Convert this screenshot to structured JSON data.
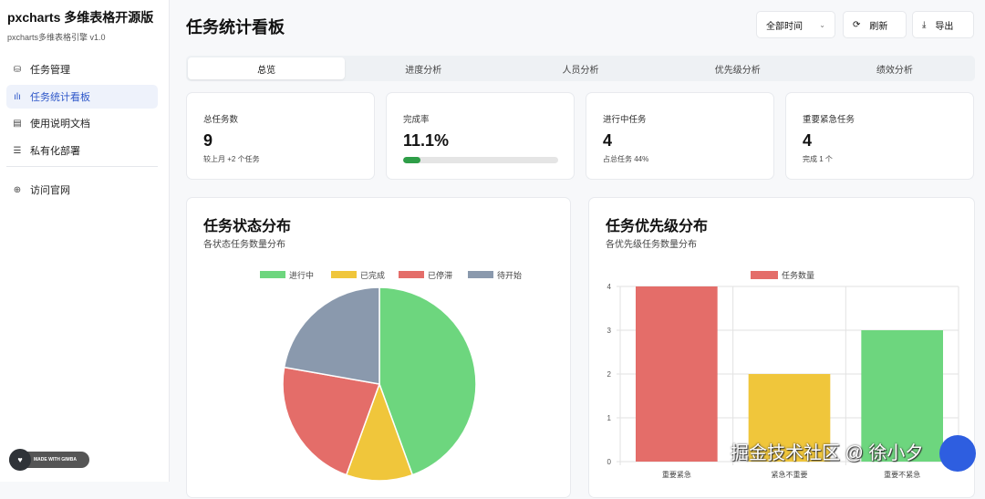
{
  "sidebar": {
    "brand": "pxcharts 多维表格开源版",
    "subtitle": "pxcharts多维表格引擎 v1.0",
    "items": [
      {
        "label": "任务管理",
        "icon": "database-icon"
      },
      {
        "label": "任务统计看板",
        "icon": "bar-chart-icon"
      },
      {
        "label": "使用说明文档",
        "icon": "document-icon"
      },
      {
        "label": "私有化部署",
        "icon": "server-icon"
      }
    ],
    "external": {
      "label": "访问官网",
      "icon": "globe-icon"
    },
    "badge": "MADE WITH GIMBA"
  },
  "header": {
    "title": "任务统计看板",
    "time_filter": "全部时间",
    "refresh": "刷新",
    "export": "导出"
  },
  "tabs": [
    "总览",
    "进度分析",
    "人员分析",
    "优先级分析",
    "绩效分析"
  ],
  "stats": [
    {
      "label": "总任务数",
      "value": "9",
      "note": "较上月 +2 个任务"
    },
    {
      "label": "完成率",
      "value": "11.1%",
      "progress": 11.1
    },
    {
      "label": "进行中任务",
      "value": "4",
      "note": "占总任务 44%"
    },
    {
      "label": "重要紧急任务",
      "value": "4",
      "note": "完成 1 个"
    }
  ],
  "chart_data": [
    {
      "type": "pie",
      "title": "任务状态分布",
      "subtitle": "各状态任务数量分布",
      "legend_position": "top",
      "categories": [
        "进行中",
        "已完成",
        "已停滞",
        "待开始"
      ],
      "values": [
        4,
        1,
        2,
        2
      ],
      "colors": [
        "#6dd67e",
        "#f0c63b",
        "#e46d69",
        "#8a99ad"
      ]
    },
    {
      "type": "bar",
      "title": "任务优先级分布",
      "subtitle": "各优先级任务数量分布",
      "legend_position": "top",
      "series": [
        {
          "name": "任务数量",
          "values": [
            4,
            2,
            3
          ]
        }
      ],
      "categories": [
        "重要紧急",
        "紧急不重要",
        "重要不紧急"
      ],
      "colors": [
        "#e46d69",
        "#f0c63b",
        "#6dd67e"
      ],
      "ylim": [
        0,
        4
      ],
      "yticks": [
        "0",
        "1",
        "2",
        "3",
        "4"
      ],
      "grid": true
    }
  ],
  "watermark": "掘金技术社区 @ 徐小夕"
}
